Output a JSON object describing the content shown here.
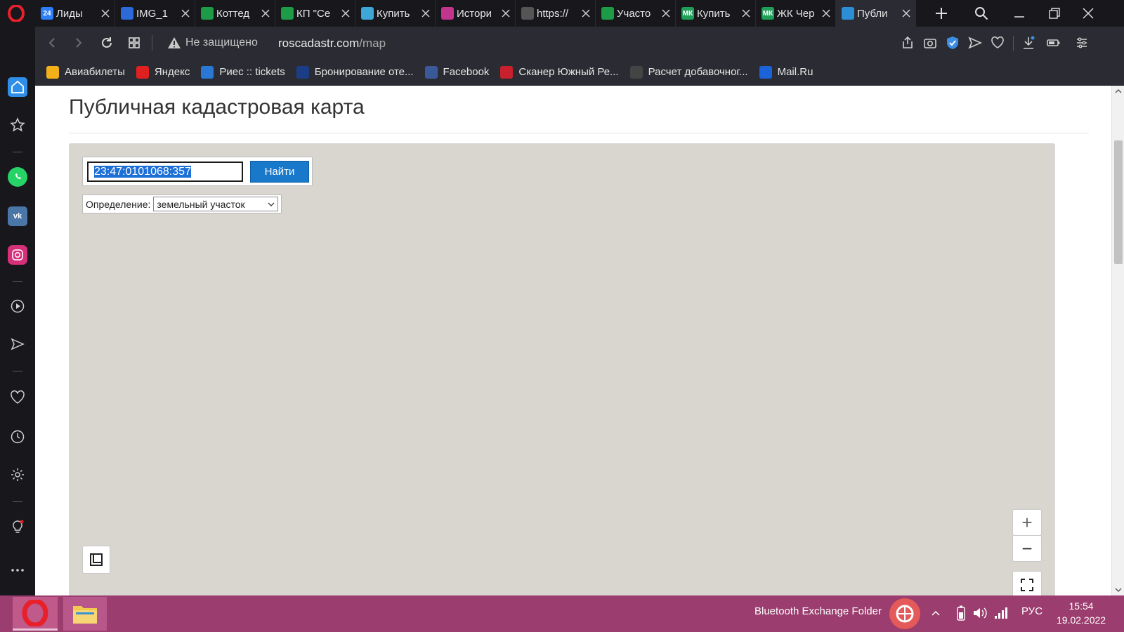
{
  "tabs": [
    {
      "title": "Лиды",
      "fav_text": "24",
      "fav_color": "#2d7ff9",
      "active": false
    },
    {
      "title": "IMG_1",
      "fav_text": "",
      "fav_color": "#2b6ad8",
      "active": false
    },
    {
      "title": "Коттед",
      "fav_text": "",
      "fav_color": "#1e9b46",
      "active": false
    },
    {
      "title": "КП \"Се",
      "fav_text": "",
      "fav_color": "#1e9b46",
      "active": false
    },
    {
      "title": "Купить",
      "fav_text": "",
      "fav_color": "#3fa6d8",
      "active": false
    },
    {
      "title": "Истори",
      "fav_text": "",
      "fav_color": "#c1358f",
      "active": false
    },
    {
      "title": "https://",
      "fav_text": "",
      "fav_color": "#555555",
      "active": false
    },
    {
      "title": "Участо",
      "fav_text": "",
      "fav_color": "#1e9b46",
      "active": false
    },
    {
      "title": "Купить",
      "fav_text": "МК",
      "fav_color": "#1f9f57",
      "active": false
    },
    {
      "title": "ЖК Чер",
      "fav_text": "МК",
      "fav_color": "#1f9f57",
      "active": false
    },
    {
      "title": "Публи",
      "fav_text": "",
      "fav_color": "#2c8fd6",
      "active": true
    }
  ],
  "address": {
    "security": "Не защищено",
    "domain": "roscadastr.com",
    "path": "/map"
  },
  "bookmarks": [
    {
      "label": "Авиабилеты",
      "icon": "plane-icon",
      "color": "#f2b019"
    },
    {
      "label": "Яндекс",
      "icon": "yandex-icon",
      "color": "#e02020"
    },
    {
      "label": "Риес :: tickets",
      "icon": "cube-icon",
      "color": "#2a78d6"
    },
    {
      "label": "Бронирование оте...",
      "icon": "booking-icon",
      "color": "#1a3d85"
    },
    {
      "label": "Facebook",
      "icon": "facebook-icon",
      "color": "#3b5998"
    },
    {
      "label": "Сканер Южный Ре...",
      "icon": "scanner-icon",
      "color": "#c8202c"
    },
    {
      "label": "Расчет добавочног...",
      "icon": "calc-icon",
      "color": "#444444"
    },
    {
      "label": "Mail.Ru",
      "icon": "mail-icon",
      "color": "#1b63d8"
    }
  ],
  "page": {
    "title": "Публичная кадастровая карта"
  },
  "search": {
    "value": "23:47:0101068:357",
    "button": "Найти"
  },
  "definition": {
    "label": "Определение:",
    "selected": "земельный участок"
  },
  "map_controls": {
    "zoom_in": "+",
    "zoom_out": "−"
  },
  "taskbar": {
    "tray_label": "Bluetooth Exchange Folder",
    "lang": "РУС",
    "time": "15:54",
    "date": "19.02.2022"
  }
}
